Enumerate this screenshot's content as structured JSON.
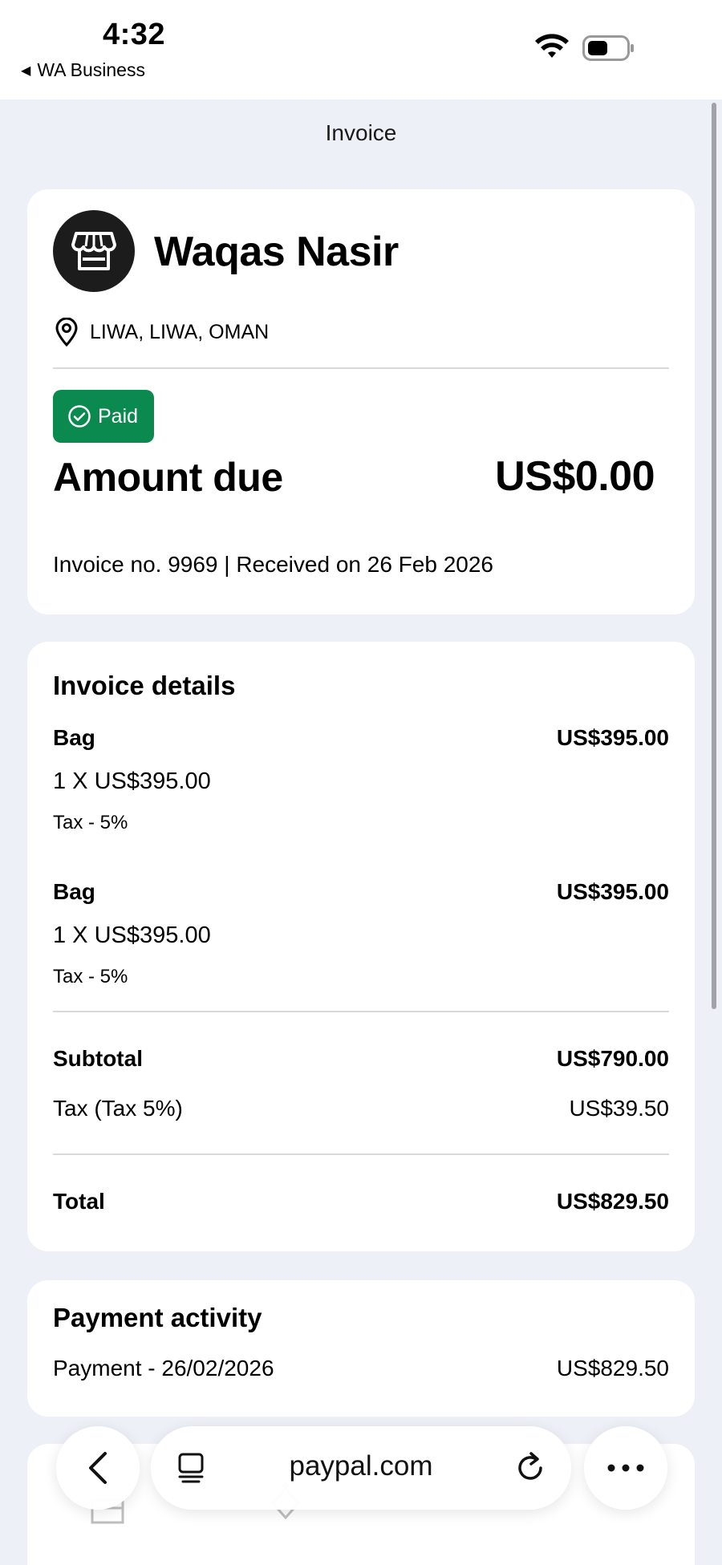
{
  "status_bar": {
    "time": "4:32",
    "back_app": "WA Business"
  },
  "header": {
    "title": "Invoice"
  },
  "merchant": {
    "name": "Waqas Nasir",
    "location": "LIWA, LIWA, OMAN",
    "status_badge": "Paid",
    "amount_label": "Amount due",
    "amount_value": "US$0.00",
    "invoice_meta": "Invoice no. 9969 | Received on 26 Feb 2026"
  },
  "invoice_details": {
    "title": "Invoice details",
    "items": [
      {
        "name": "Bag",
        "price": "US$395.00",
        "qty_line": "1 X US$395.00",
        "tax": "Tax - 5%"
      },
      {
        "name": "Bag",
        "price": "US$395.00",
        "qty_line": "1 X US$395.00",
        "tax": "Tax - 5%"
      }
    ],
    "subtotal_label": "Subtotal",
    "subtotal_value": "US$790.00",
    "tax_label": "Tax (Tax 5%)",
    "tax_value": "US$39.50",
    "total_label": "Total",
    "total_value": "US$829.50"
  },
  "payment_activity": {
    "title": "Payment activity",
    "entry_label": "Payment - 26/02/2026",
    "entry_value": "US$829.50"
  },
  "browser": {
    "url": "paypal.com"
  },
  "colors": {
    "background": "#eef0f7",
    "paid_badge": "#0b8a4f",
    "avatar": "#1c1c1c"
  }
}
